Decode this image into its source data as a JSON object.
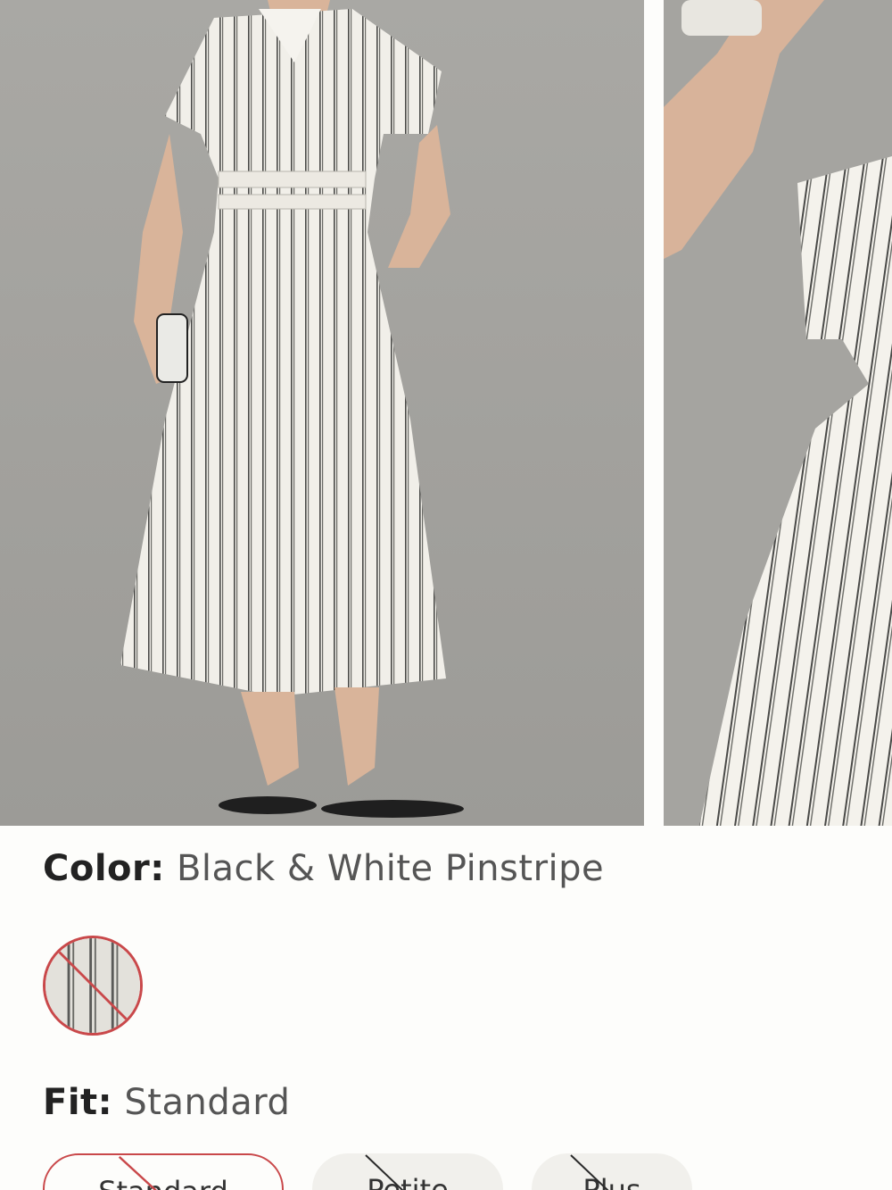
{
  "product": {
    "images": [
      {
        "name": "model-full-length"
      },
      {
        "name": "model-detail-crop"
      }
    ]
  },
  "color": {
    "label": "Color:",
    "value": "Black & White Pinstripe",
    "swatch_state": "unavailable",
    "swatch_border": "#c9484a"
  },
  "fit": {
    "label": "Fit:",
    "value": "Standard",
    "options": [
      {
        "label": "Standard",
        "selected": true,
        "unavailable": true
      },
      {
        "label": "Petite",
        "selected": false,
        "unavailable": true
      },
      {
        "label": "Plus",
        "selected": false,
        "unavailable": true
      }
    ]
  },
  "colors": {
    "accent": "#c9484a",
    "background": "#fdfdfb",
    "photo_background": "#a7a6a2"
  }
}
